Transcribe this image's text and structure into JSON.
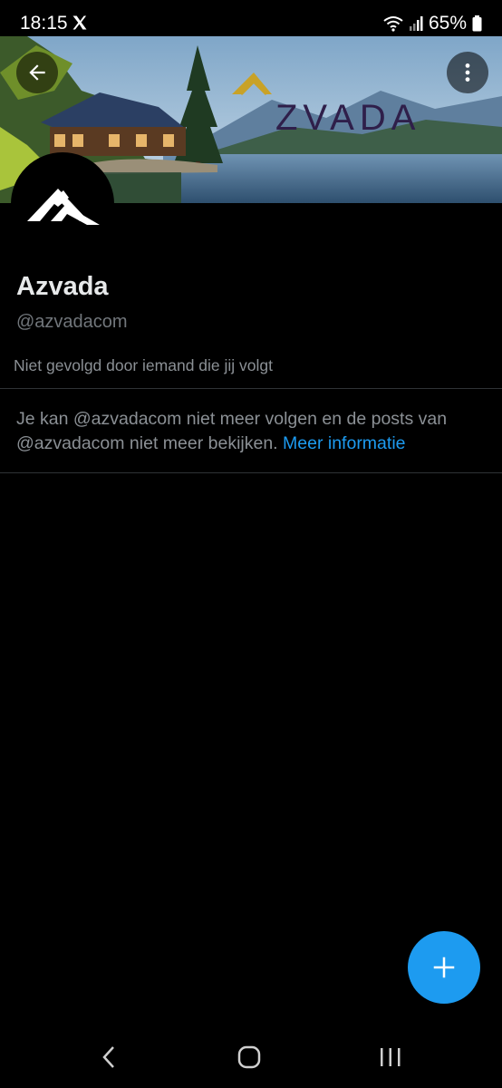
{
  "status_bar": {
    "time": "18:15",
    "battery": "65%"
  },
  "banner": {
    "brand_text": "ZVADA"
  },
  "profile": {
    "display_name": "Azvada",
    "handle": "@azvadacom",
    "followed_note": "Niet gevolgd door iemand die jij volgt"
  },
  "notice": {
    "text": "Je kan @azvadacom niet meer volgen en de posts van @azvadacom niet meer bekijken.",
    "link_label": "Meer informatie"
  },
  "colors": {
    "accent": "#1d9bf0",
    "background": "#000000",
    "brand_gold": "#c9a227",
    "brand_purple": "#2f1f4a"
  },
  "icons": {
    "status": [
      "x-logo-icon",
      "wifi-icon",
      "signal-icon",
      "battery-icon"
    ],
    "header": [
      "back-arrow-icon",
      "more-vertical-icon"
    ],
    "fab": "plus-icon",
    "system_nav": [
      "nav-back-icon",
      "nav-home-icon",
      "nav-recents-icon"
    ]
  }
}
